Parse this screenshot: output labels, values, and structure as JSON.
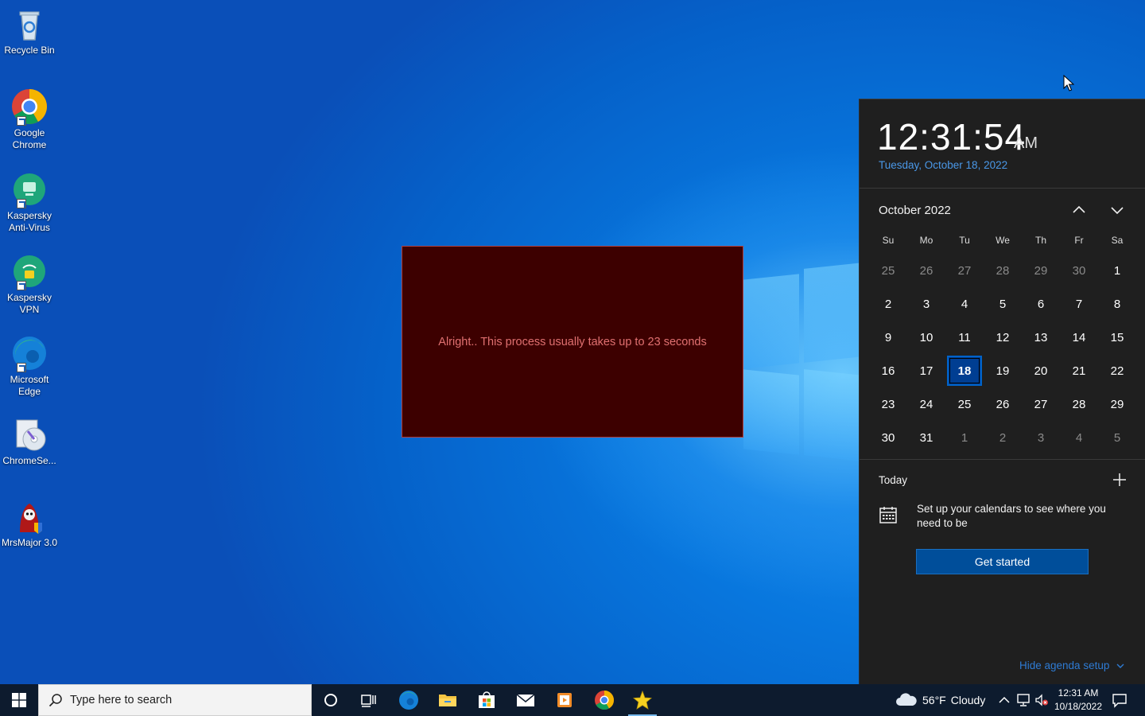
{
  "desktop": {
    "icons": [
      {
        "label": "Recycle Bin"
      },
      {
        "label": "Google Chrome"
      },
      {
        "label": "Kaspersky Anti-Virus"
      },
      {
        "label": "Kaspersky VPN"
      },
      {
        "label": "Microsoft Edge"
      },
      {
        "label": "ChromeSe..."
      },
      {
        "label": "MrsMajor 3.0"
      }
    ]
  },
  "dialog": {
    "message": "Alright.. This process usually takes up to 23 seconds",
    "background": "#3d0000",
    "text_color": "#e07070"
  },
  "flyout": {
    "time": "12:31:54",
    "ampm": "AM",
    "date_long": "Tuesday, October 18, 2022",
    "month_label": "October 2022",
    "weekdays": [
      "Su",
      "Mo",
      "Tu",
      "We",
      "Th",
      "Fr",
      "Sa"
    ],
    "days": [
      {
        "n": "25",
        "dim": true
      },
      {
        "n": "26",
        "dim": true
      },
      {
        "n": "27",
        "dim": true
      },
      {
        "n": "28",
        "dim": true
      },
      {
        "n": "29",
        "dim": true
      },
      {
        "n": "30",
        "dim": true
      },
      {
        "n": "1"
      },
      {
        "n": "2"
      },
      {
        "n": "3"
      },
      {
        "n": "4"
      },
      {
        "n": "5"
      },
      {
        "n": "6"
      },
      {
        "n": "7"
      },
      {
        "n": "8"
      },
      {
        "n": "9"
      },
      {
        "n": "10"
      },
      {
        "n": "11"
      },
      {
        "n": "12"
      },
      {
        "n": "13"
      },
      {
        "n": "14"
      },
      {
        "n": "15"
      },
      {
        "n": "16"
      },
      {
        "n": "17"
      },
      {
        "n": "18",
        "today": true
      },
      {
        "n": "19"
      },
      {
        "n": "20"
      },
      {
        "n": "21"
      },
      {
        "n": "22"
      },
      {
        "n": "23"
      },
      {
        "n": "24"
      },
      {
        "n": "25"
      },
      {
        "n": "26"
      },
      {
        "n": "27"
      },
      {
        "n": "28"
      },
      {
        "n": "29"
      },
      {
        "n": "30"
      },
      {
        "n": "31"
      },
      {
        "n": "1",
        "dim": true
      },
      {
        "n": "2",
        "dim": true
      },
      {
        "n": "3",
        "dim": true
      },
      {
        "n": "4",
        "dim": true
      },
      {
        "n": "5",
        "dim": true
      }
    ],
    "agenda_title": "Today",
    "agenda_message": "Set up your calendars to see where you need to be",
    "get_started_label": "Get started",
    "hide_agenda_label": "Hide agenda setup",
    "accent_color": "#0063c9"
  },
  "taskbar": {
    "search_placeholder": "Type here to search",
    "pinned": [
      "cortana-icon",
      "task-view-icon",
      "edge-icon",
      "file-explorer-icon",
      "store-icon",
      "mail-icon",
      "media-icon",
      "chrome-icon",
      "star-app-icon"
    ],
    "weather_temp": "56°F",
    "weather_text": "Cloudy",
    "clock_time": "12:31 AM",
    "clock_date": "10/18/2022"
  }
}
